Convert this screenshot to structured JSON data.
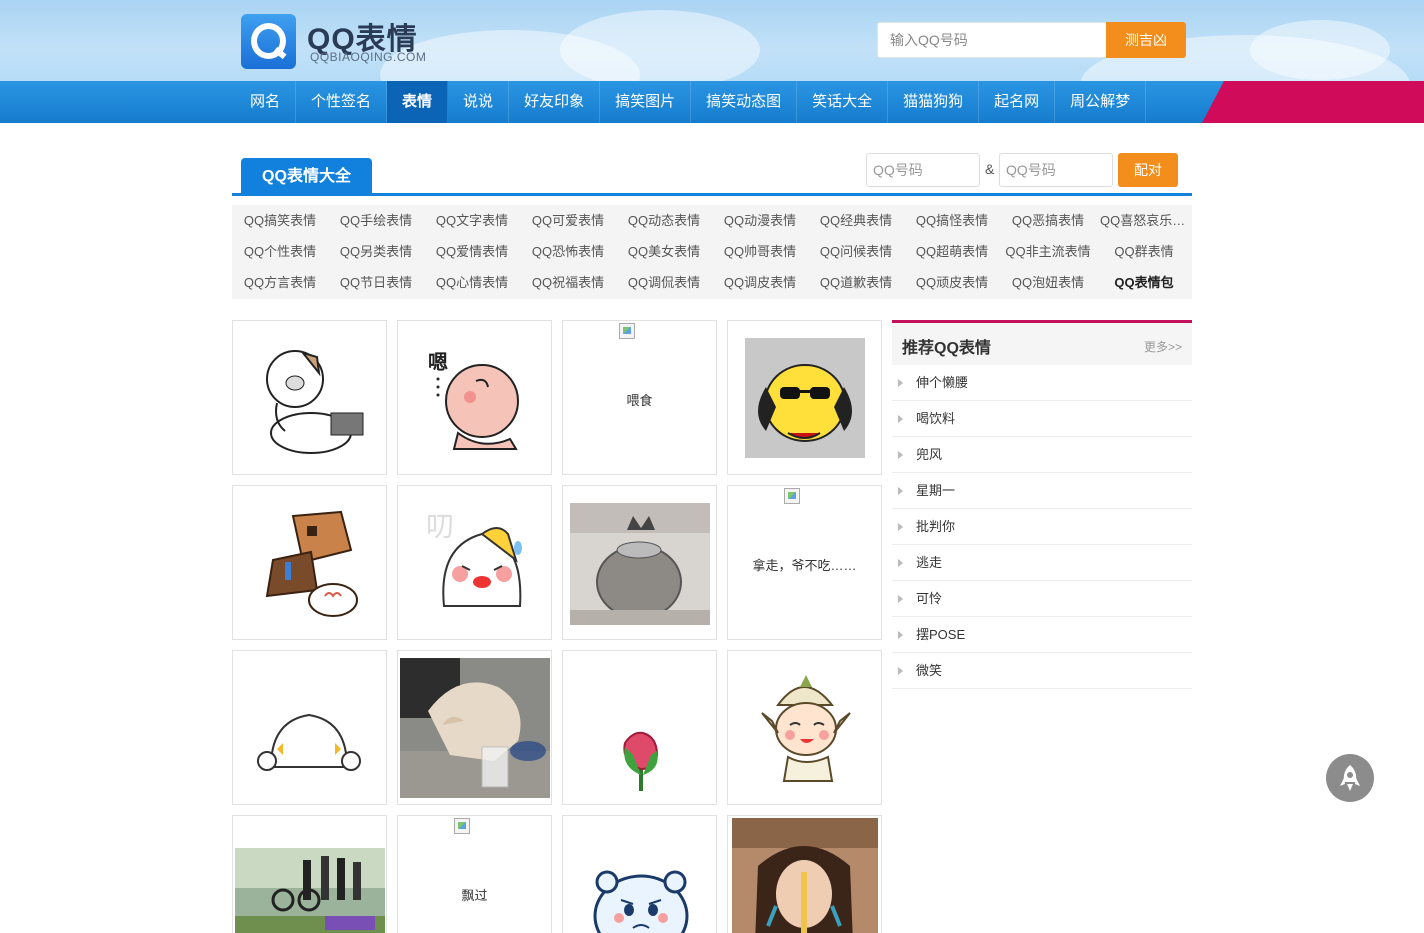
{
  "header": {
    "logo_title": "QQ表情",
    "logo_sub": "QQBIAOQING.COM",
    "search_placeholder": "输入QQ号码",
    "search_button": "测吉凶"
  },
  "nav": [
    {
      "label": "网名",
      "active": false
    },
    {
      "label": "个性签名",
      "active": false
    },
    {
      "label": "表情",
      "active": true
    },
    {
      "label": "说说",
      "active": false
    },
    {
      "label": "好友印象",
      "active": false
    },
    {
      "label": "搞笑图片",
      "active": false
    },
    {
      "label": "搞笑动态图",
      "active": false
    },
    {
      "label": "笑话大全",
      "active": false
    },
    {
      "label": "猫猫狗狗",
      "active": false
    },
    {
      "label": "起名网",
      "active": false
    },
    {
      "label": "周公解梦",
      "active": false
    }
  ],
  "section": {
    "tab_label": "QQ表情大全",
    "pair_placeholder_1": "QQ号码",
    "pair_separator": "&",
    "pair_placeholder_2": "QQ号码",
    "pair_button": "配对"
  },
  "categories": [
    "QQ搞笑表情",
    "QQ手绘表情",
    "QQ文字表情",
    "QQ可爱表情",
    "QQ动态表情",
    "QQ动漫表情",
    "QQ经典表情",
    "QQ搞怪表情",
    "QQ恶搞表情",
    "QQ喜怒哀乐表情",
    "QQ个性表情",
    "QQ另类表情",
    "QQ爱情表情",
    "QQ恐怖表情",
    "QQ美女表情",
    "QQ帅哥表情",
    "QQ问候表情",
    "QQ超萌表情",
    "QQ非主流表情",
    "QQ群表情",
    "QQ方言表情",
    "QQ节日表情",
    "QQ心情表情",
    "QQ祝福表情",
    "QQ调侃表情",
    "QQ调皮表情",
    "QQ道歉表情",
    "QQ顽皮表情",
    "QQ泡妞表情",
    "QQ表情包"
  ],
  "cards": [
    {
      "type": "cat-bath"
    },
    {
      "type": "baby-en",
      "caption": "嗯"
    },
    {
      "type": "broken",
      "caption": "喂食"
    },
    {
      "type": "yellow-dog"
    },
    {
      "type": "box-man"
    },
    {
      "type": "bun-cry",
      "caption": "叨"
    },
    {
      "type": "cat-bowl"
    },
    {
      "type": "broken",
      "caption": "拿走，爷不吃……"
    },
    {
      "type": "blob"
    },
    {
      "type": "cat-milk"
    },
    {
      "type": "rose-bud"
    },
    {
      "type": "elf-girl"
    },
    {
      "type": "bike-photo"
    },
    {
      "type": "broken",
      "caption": "飘过"
    },
    {
      "type": "bear-sad"
    },
    {
      "type": "girl-noodle"
    }
  ],
  "sidebar": {
    "title": "推荐QQ表情",
    "more": "更多>>",
    "items": [
      "伸个懒腰",
      "喝饮料",
      "兜风",
      "星期一",
      "批判你",
      "逃走",
      "可怜",
      "摆POSE",
      "微笑"
    ]
  },
  "colors": {
    "primary_blue": "#1281dd",
    "accent_orange": "#f38d1b",
    "accent_pink": "#c4105d"
  },
  "icons": {
    "back_to_top": "rocket-icon"
  }
}
